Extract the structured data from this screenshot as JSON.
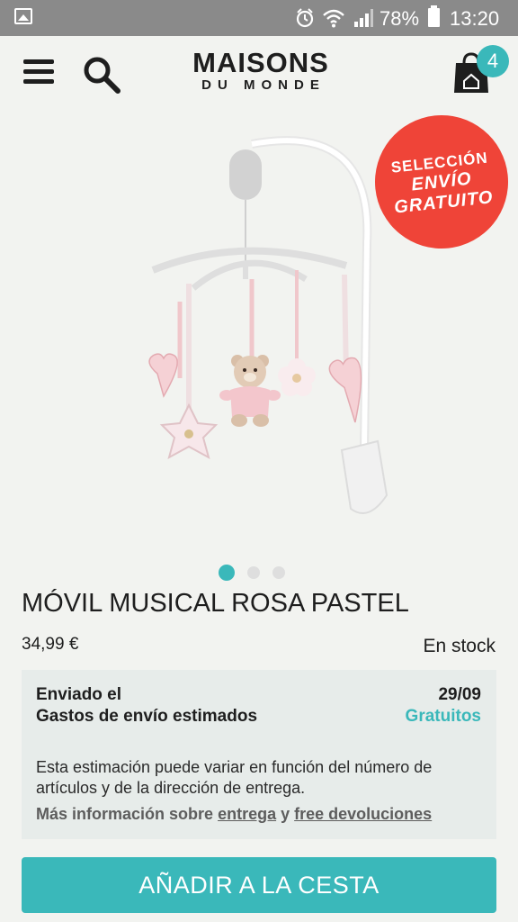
{
  "status_bar": {
    "battery_percent": "78%",
    "time": "13:20"
  },
  "header": {
    "logo_line1": "MAISONS",
    "logo_line2": "DU MONDE",
    "cart_count": "4"
  },
  "promo_badge": {
    "line1": "SELECCIÓN",
    "line2": "ENVÍO",
    "line3": "GRATUITO",
    "color": "#ef4438"
  },
  "carousel": {
    "count": 3,
    "active_index": 0
  },
  "product": {
    "title": "MÓVIL MUSICAL ROSA PASTEL",
    "price": "34,99 €",
    "stock": "En stock"
  },
  "shipping": {
    "sent_label": "Enviado el",
    "cost_label": "Gastos de envío estimados",
    "date": "29/09",
    "cost": "Gratuitos",
    "note": "Esta estimación puede variar en función del número de artículos y de la dirección de entrega.",
    "more_prefix": "Más información sobre",
    "link_delivery": "entrega",
    "conjunction": "y",
    "link_returns": "free devoluciones"
  },
  "add_to_cart": {
    "label": "AÑADIR A LA CESTA"
  },
  "colors": {
    "accent": "#3ab8ba",
    "promo": "#ef4438",
    "background": "#f2f3f0"
  }
}
